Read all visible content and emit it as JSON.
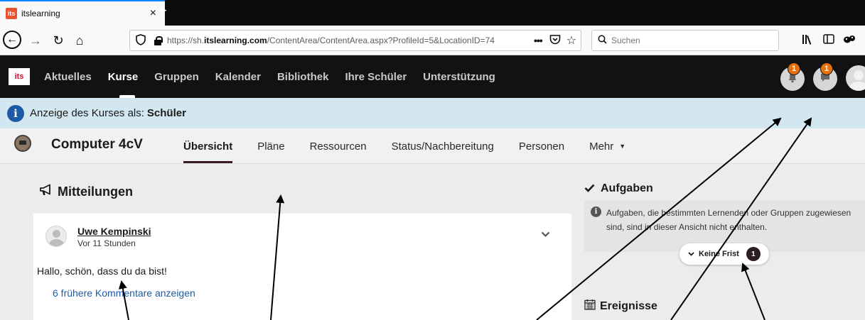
{
  "browser": {
    "tab": {
      "favicon": "its",
      "title": "itslearning",
      "close": "×"
    },
    "new_tab": "+",
    "nav": {
      "back": "←",
      "forward": "→",
      "reload": "↻",
      "home": "⌂"
    },
    "url": {
      "prefix": "https://sh.",
      "host": "itslearning.com",
      "path": "/ContentArea/ContentArea.aspx?ProfileId=5&LocationID=74"
    },
    "url_more": "•••",
    "search_placeholder": "Suchen",
    "toolbar_icons": [
      "library-icon",
      "sidebar-icon",
      "extension-icon"
    ]
  },
  "app": {
    "logo": "its",
    "nav": [
      "Aktuelles",
      "Kurse",
      "Gruppen",
      "Kalender",
      "Bibliothek",
      "Ihre Schüler",
      "Unterstützung"
    ],
    "active_nav": "Kurse",
    "notifications_badge": "1",
    "messages_badge": "1"
  },
  "banner": {
    "text": "Anzeige des Kurses als:",
    "role": "Schüler"
  },
  "course": {
    "title": "Computer 4cV",
    "tabs": [
      "Übersicht",
      "Pläne",
      "Ressourcen",
      "Status/Nachbereitung",
      "Personen",
      "Mehr"
    ],
    "active_tab": "Übersicht"
  },
  "announcements": {
    "title": "Mitteilungen",
    "post": {
      "author": "Uwe Kempinski",
      "time": "Vor 11 Stunden",
      "body": "Hallo, schön, dass du da bist!",
      "more_comments": "6 frühere Kommentare anzeigen"
    }
  },
  "tasks": {
    "title": "Aufgaben",
    "note": "Aufgaben, die bestimmten Lernenden oder Gruppen zugewiesen sind, sind in dieser Ansicht nicht enthalten.",
    "deadline_label": "Keine Frist",
    "deadline_count": "1"
  },
  "events": {
    "title": "Ereignisse"
  },
  "colors": {
    "app_header": "#121212",
    "banner_bg": "#d3e7f0",
    "badge": "#e8700c",
    "link": "#1e5aa8",
    "active_underline": "#3a1a2a"
  }
}
